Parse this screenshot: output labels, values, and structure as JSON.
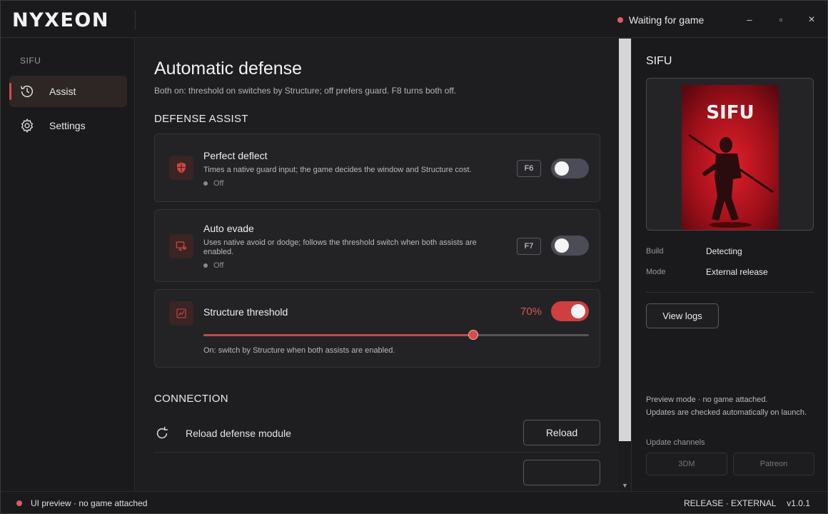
{
  "app": {
    "logo": "NYXEON",
    "status": "Waiting for game",
    "minimize_glyph": "–",
    "maximize_glyph": "▫",
    "close_glyph": "×"
  },
  "sidebar": {
    "section": "SIFU",
    "items": [
      {
        "label": "Assist",
        "icon": "history-icon",
        "active": true
      },
      {
        "label": "Settings",
        "icon": "gear-icon",
        "active": false
      }
    ]
  },
  "main": {
    "title": "Automatic defense",
    "subtitle": "Both on: threshold on switches by Structure; off prefers guard. F8 turns both off.",
    "defense_section": "DEFENSE ASSIST",
    "cards": [
      {
        "title": "Perfect deflect",
        "description": "Times a native guard input; the game decides the window and Structure cost.",
        "state": "Off",
        "key": "F6",
        "enabled": false,
        "icon": "shield-icon"
      },
      {
        "title": "Auto evade",
        "description": "Uses native avoid or dodge; follows the threshold switch when both assists are enabled.",
        "state": "Off",
        "key": "F7",
        "enabled": false,
        "icon": "evade-icon"
      }
    ],
    "threshold": {
      "title": "Structure threshold",
      "value_label": "70%",
      "value": 70,
      "enabled": true,
      "note": "On: switch by Structure when both assists are enabled.",
      "icon": "chart-icon"
    },
    "connection_section": "CONNECTION",
    "connection_rows": [
      {
        "label": "Reload defense module",
        "button": "Reload",
        "icon": "reload-icon"
      }
    ]
  },
  "right_panel": {
    "title": "SIFU",
    "cover_text": "SIFU",
    "build_label": "Build",
    "build_value": "Detecting",
    "mode_label": "Mode",
    "mode_value": "External release",
    "view_logs": "View logs",
    "note1": "Preview mode · no game attached.",
    "note2": "Updates are checked automatically on launch.",
    "channels_label": "Update channels",
    "channels": [
      "3DM",
      "Patreon"
    ]
  },
  "statusbar": {
    "left": "UI preview · no game attached",
    "release": "RELEASE · EXTERNAL",
    "version": "v1.0.1"
  },
  "colors": {
    "accent": "#cf3f3f",
    "status_dot": "#e05a63",
    "background": "#1e1e20"
  }
}
